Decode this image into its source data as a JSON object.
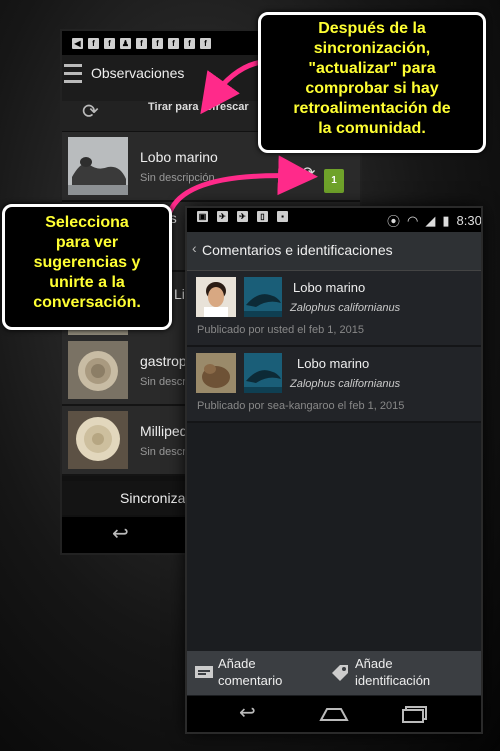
{
  "back_screen": {
    "title": "Observaciones",
    "pull_to_refresh": "Tirar para refrescar",
    "rows": [
      {
        "title": "Lobo marino",
        "description": "Sin descripción"
      },
      {
        "title": "ns",
        "description": ""
      },
      {
        "title": "Li",
        "description": ""
      },
      {
        "title": "gastrop",
        "description": "Sin descri"
      },
      {
        "title": "Milliped",
        "description": "Sin descri"
      }
    ],
    "sync_count": "1",
    "sync_label": "Sincroniza"
  },
  "front_screen": {
    "status_time": "8:30",
    "title": "Comentarios e identificaciones",
    "comments": [
      {
        "common_name": "Lobo marino",
        "scientific_name": "Zalophus californianus",
        "posted_by": "Publicado por usted el feb 1, 2015"
      },
      {
        "common_name": "Lobo marino",
        "scientific_name": "Zalophus californianus",
        "posted_by": "Publicado por sea-kangaroo el feb 1, 2015"
      }
    ],
    "add_comment": "Añade\ncomentario",
    "add_identification": "Añade\nidentificación"
  },
  "callouts": {
    "top_lines": [
      "Después de la",
      "sincronización,",
      "\"actualizar\" para",
      "comprobar si hay",
      "retroalimentación de",
      "la comunidad."
    ],
    "left_lines": [
      "Selecciona",
      "para ver",
      "sugerencias y",
      "unirte a la",
      "conversación."
    ]
  },
  "colors": {
    "callout_text": "#ffff33",
    "arrow": "#ff2a8a",
    "badge": "#6fa22a"
  }
}
